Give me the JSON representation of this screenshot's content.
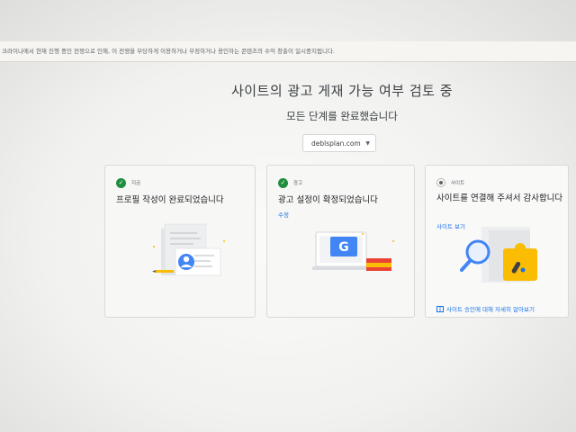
{
  "banner": {
    "text": "크라이나에서 현재 진행 중인 전쟁으로 인해, 이 전쟁을 부당하게 이용하거나 부정하거나 용인하는 콘텐츠의 수익 창출이 일시중지됩니다."
  },
  "header": {
    "title": "사이트의 광고 게재 가능 여부 검토 중",
    "subtitle": "모든 단계를 완료했습니다"
  },
  "site_selector": {
    "value": "deblsplan.com"
  },
  "cards": [
    {
      "status": "complete",
      "step_label": "지금",
      "title": "프로필 작성이 완료되었습니다"
    },
    {
      "status": "complete",
      "step_label": "광고",
      "title": "광고 설정이 확정되었습니다",
      "action_label": "수정"
    },
    {
      "status": "in-progress",
      "step_label": "사이트",
      "title": "사이트를 연결해 주셔서 감사합니다",
      "action_label": "사이트 보기",
      "learn_more": "사이트 승인에 대해 자세히 알아보기"
    }
  ],
  "icons": {
    "check": "check-circle-icon",
    "progress": "progress-dot-icon",
    "dropdown": "chevron-down-icon",
    "learn": "book-icon"
  },
  "colors": {
    "accent": "#1a73e8",
    "success": "#1e8e3e",
    "google_blue": "#4285f4",
    "adsense_yellow": "#fbbc04"
  }
}
